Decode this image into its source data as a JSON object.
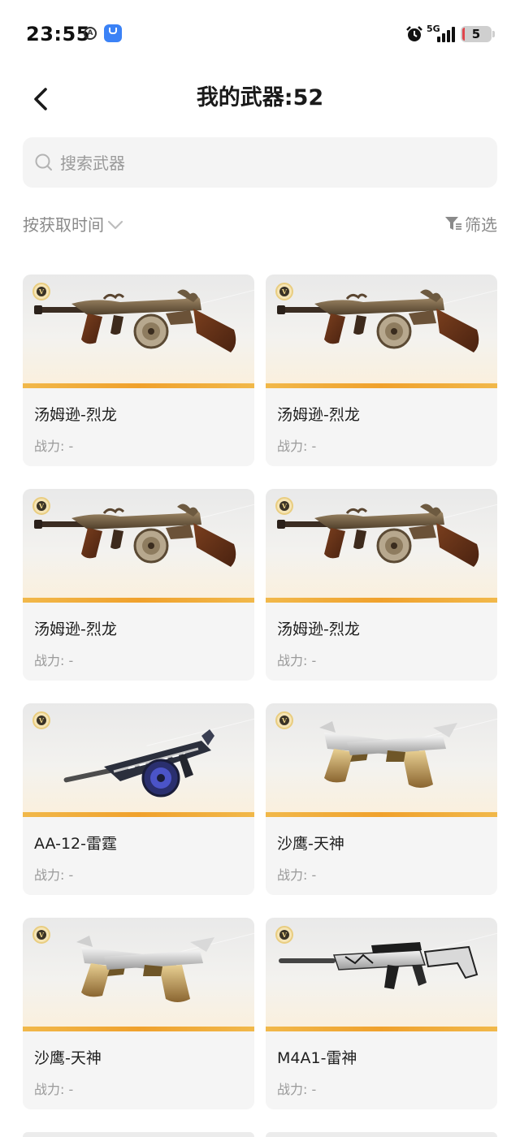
{
  "status_bar": {
    "time": "23:55",
    "network": "5G",
    "battery": "5"
  },
  "header": {
    "title": "我的武器:52"
  },
  "search": {
    "placeholder": "搜索武器"
  },
  "sort": {
    "label": "按获取时间"
  },
  "filter": {
    "label": "筛选"
  },
  "badge_letter": "V",
  "cards": [
    {
      "name": "汤姆逊-烈龙",
      "power": "战力: -",
      "weapon_icon": "tommy-gun-dragon-icon"
    },
    {
      "name": "汤姆逊-烈龙",
      "power": "战力: -",
      "weapon_icon": "tommy-gun-dragon-icon"
    },
    {
      "name": "汤姆逊-烈龙",
      "power": "战力: -",
      "weapon_icon": "tommy-gun-dragon-icon"
    },
    {
      "name": "汤姆逊-烈龙",
      "power": "战力: -",
      "weapon_icon": "tommy-gun-dragon-icon"
    },
    {
      "name": "AA-12-雷霆",
      "power": "战力: -",
      "weapon_icon": "shotgun-drum-icon"
    },
    {
      "name": "沙鹰-天神",
      "power": "战力: -",
      "weapon_icon": "dual-desert-eagle-icon"
    },
    {
      "name": "沙鹰-天神",
      "power": "战力: -",
      "weapon_icon": "dual-desert-eagle-icon"
    },
    {
      "name": "M4A1-雷神",
      "power": "战力: -",
      "weapon_icon": "assault-rifle-icon"
    }
  ],
  "colors": {
    "accent_band": "#f0a12c",
    "card_bg": "#f5f5f5",
    "muted_text": "#9a9a9a"
  }
}
